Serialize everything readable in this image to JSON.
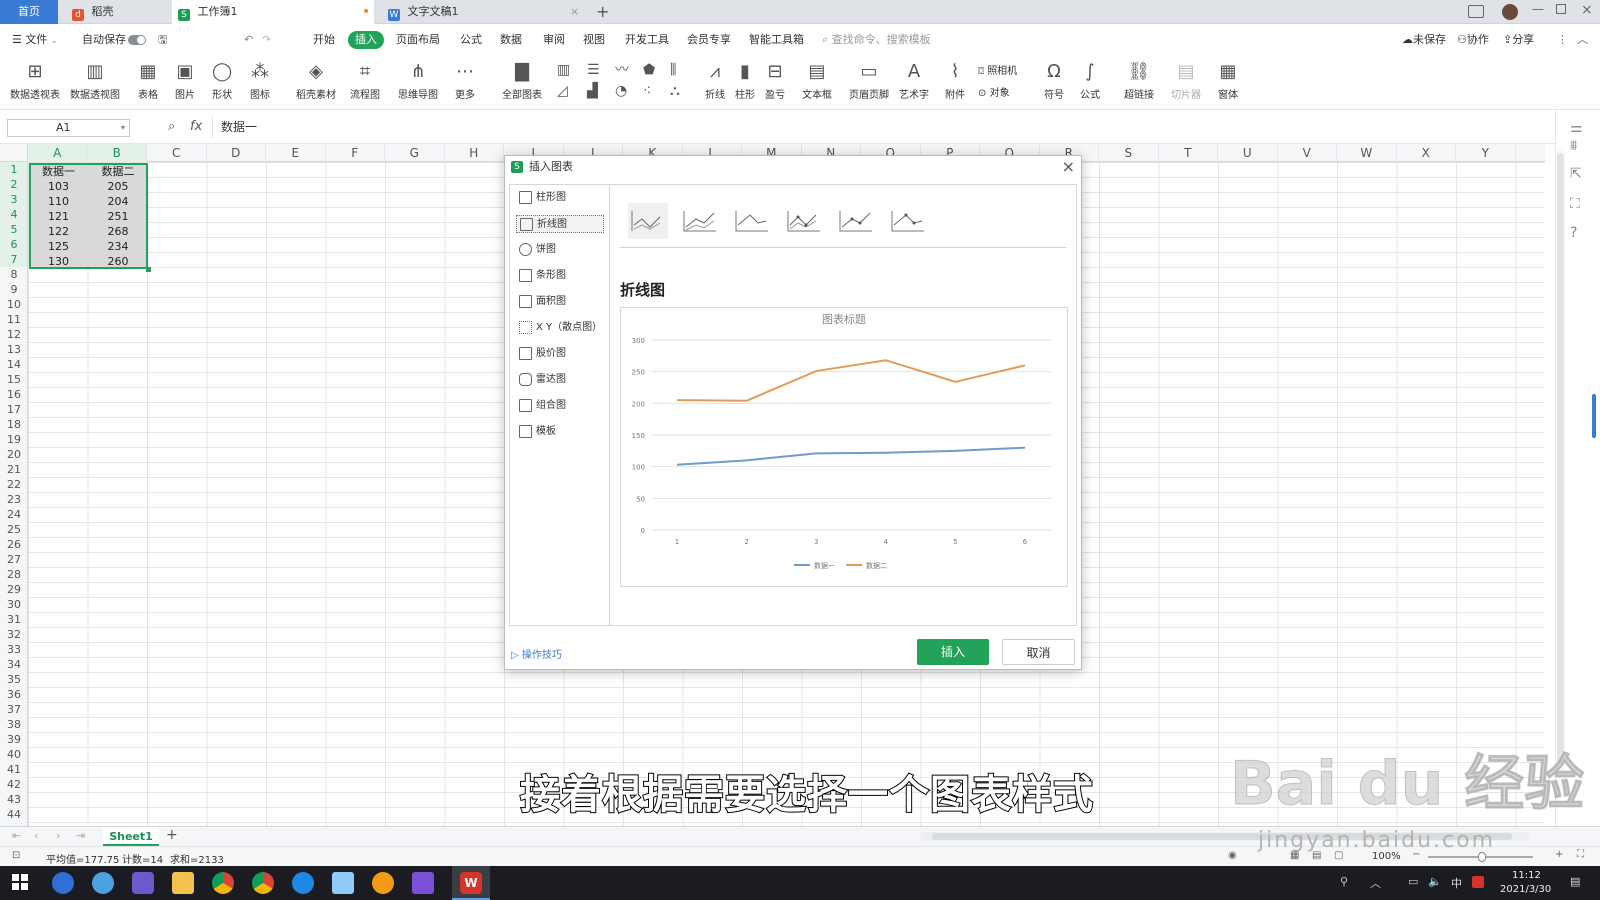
{
  "tabs": [
    {
      "label": "首页"
    },
    {
      "label": "稻壳"
    },
    {
      "label": "工作簿1"
    },
    {
      "label": "文字文稿1"
    }
  ],
  "menu": {
    "file": "文件",
    "autosave": "自动保存",
    "items": [
      "开始",
      "插入",
      "页面布局",
      "公式",
      "数据",
      "审阅",
      "视图",
      "开发工具",
      "会员专享",
      "智能工具箱"
    ],
    "active": "插入",
    "search_placeholder": "查找命令、搜索模板",
    "unsaved": "未保存",
    "collab": "协作",
    "share": "分享"
  },
  "ribbon": [
    "数据透视表",
    "数据透视图",
    "表格",
    "图片",
    "形状",
    "图标",
    "稻壳素材",
    "流程图",
    "思维导图",
    "更多",
    "全部图表",
    "折线",
    "柱形",
    "盈亏",
    "文本框",
    "页眉页脚",
    "艺术字",
    "附件",
    "照相机",
    "对象",
    "符号",
    "公式",
    "超链接",
    "切片器",
    "窗体"
  ],
  "formula": {
    "cell_ref": "A1",
    "fx": "fx",
    "content": "数据一"
  },
  "columns": [
    "A",
    "B",
    "C",
    "D",
    "E",
    "F",
    "G",
    "H",
    "I",
    "J",
    "K",
    "L",
    "M",
    "N",
    "O",
    "P",
    "Q",
    "R",
    "S",
    "T",
    "U",
    "V",
    "W",
    "X",
    "Y"
  ],
  "rows": [
    "1",
    "2",
    "3",
    "4",
    "5",
    "6",
    "7",
    "8",
    "9",
    "10",
    "11",
    "12",
    "13",
    "14",
    "15",
    "16",
    "17",
    "18",
    "19",
    "20",
    "21",
    "22",
    "23",
    "24",
    "25",
    "26",
    "27",
    "28",
    "29",
    "30",
    "31",
    "32",
    "33",
    "34",
    "35",
    "36",
    "37",
    "38",
    "39",
    "40",
    "41",
    "42",
    "43",
    "44"
  ],
  "table": {
    "headers": [
      "数据一",
      "数据二"
    ],
    "rows": [
      [
        "103",
        "205"
      ],
      [
        "110",
        "204"
      ],
      [
        "121",
        "251"
      ],
      [
        "122",
        "268"
      ],
      [
        "125",
        "234"
      ],
      [
        "130",
        "260"
      ]
    ]
  },
  "dialog": {
    "title": "插入图表",
    "categories": [
      "柱形图",
      "折线图",
      "饼图",
      "条形图",
      "面积图",
      "X Y（散点图）",
      "股价图",
      "雷达图",
      "组合图",
      "模板"
    ],
    "selected_category": "折线图",
    "chart_type_title": "折线图",
    "tips": "操作技巧",
    "insert": "插入",
    "cancel": "取消"
  },
  "chart_data": {
    "type": "line",
    "title": "图表标题",
    "x": [
      1,
      2,
      3,
      4,
      5,
      6
    ],
    "ylim": [
      0,
      300
    ],
    "yticks": [
      0,
      50,
      100,
      150,
      200,
      250,
      300
    ],
    "series": [
      {
        "name": "数据一",
        "values": [
          103,
          110,
          121,
          122,
          125,
          130
        ],
        "color": "#6f9cc8"
      },
      {
        "name": "数据二",
        "values": [
          205,
          204,
          251,
          268,
          234,
          260
        ],
        "color": "#e59a56"
      }
    ],
    "legend": "bottom",
    "grid": true
  },
  "sheet": {
    "name": "Sheet1"
  },
  "status": {
    "average": "平均值=177.75",
    "count": "计数=14",
    "sum": "求和=2133",
    "zoom": "100%"
  },
  "subtitle": "接着根据需要选择一个图表样式",
  "watermark": {
    "logo": "Bai du 经验",
    "url": "jingyan.baidu.com"
  },
  "clock": {
    "time": "11:12",
    "date": "2021/3/30"
  },
  "tray": {
    "ime": "中"
  },
  "colors": {
    "accent": "#22a35a",
    "series1": "#6f9cc8",
    "series2": "#e59a56",
    "selection": "#d9d9d9"
  }
}
